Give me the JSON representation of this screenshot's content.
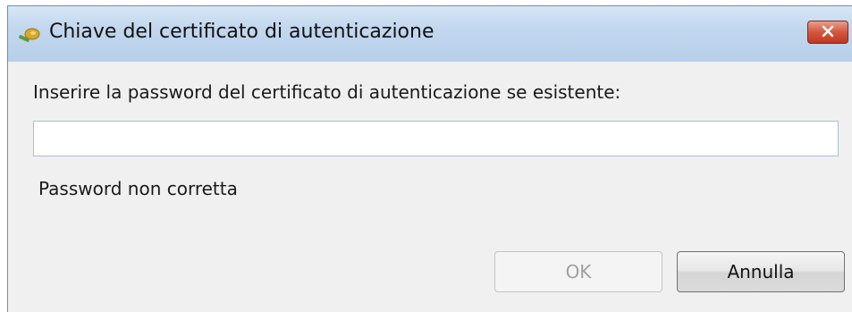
{
  "window": {
    "title": "Chiave del certificato di autenticazione",
    "title_icon": "key-icon",
    "close_icon": "close-icon"
  },
  "form": {
    "prompt": "Inserire la password del certificato di autenticazione se esistente:",
    "password_value": "",
    "error_message": "Password non corretta"
  },
  "buttons": {
    "ok_label": "OK",
    "ok_enabled": false,
    "cancel_label": "Annulla"
  },
  "colors": {
    "titlebar": "#c2d7ee",
    "close_button": "#d4563c",
    "dialog_background": "#f0f0f0"
  }
}
